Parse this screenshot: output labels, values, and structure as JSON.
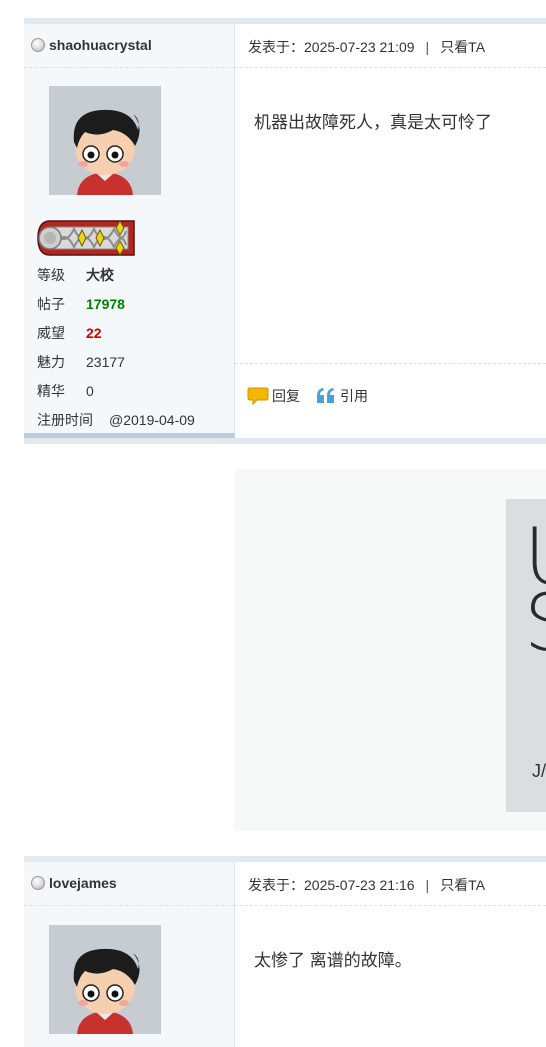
{
  "posts": [
    {
      "username": "shaohuacrystal",
      "meta_prefix": "发表于：",
      "datetime": "2025-07-23 21:09",
      "separator": "|",
      "only_ta": "只看TA",
      "content": "机器出故障死人，真是太可怜了",
      "stats": [
        {
          "key": "等级",
          "value": "大校",
          "style": "bold"
        },
        {
          "key": "帖子",
          "value": "17978",
          "style": "green"
        },
        {
          "key": "威望",
          "value": "22",
          "style": "red"
        },
        {
          "key": "魅力",
          "value": "23177",
          "style": "normal"
        },
        {
          "key": "精华",
          "value": "0",
          "style": "normal"
        },
        {
          "key": "注册时间",
          "value": "@2019-04-09",
          "style": "normal"
        }
      ],
      "actions": {
        "reply": "回复",
        "quote": "引用"
      }
    },
    {
      "username": "lovejames",
      "meta_prefix": "发表于：",
      "datetime": "2025-07-23 21:16",
      "separator": "|",
      "only_ta": "只看TA",
      "content": "太惨了 离谱的故障。"
    }
  ],
  "embedded_image": {
    "letters": [
      "U",
      "S"
    ],
    "small_text": "J/"
  },
  "icons": {
    "status": "offline-status-icon",
    "reply": "speech-bubble-icon",
    "quote": "quote-marks-icon",
    "rank": "rank-shoulder-badge-icon"
  },
  "colors": {
    "border": "#e2e9ef",
    "sidebar_bg": "#f5f8fa",
    "green": "#008000",
    "red": "#cc0000",
    "reply_icon": "#f5b800",
    "quote_icon": "#45a3d8"
  }
}
